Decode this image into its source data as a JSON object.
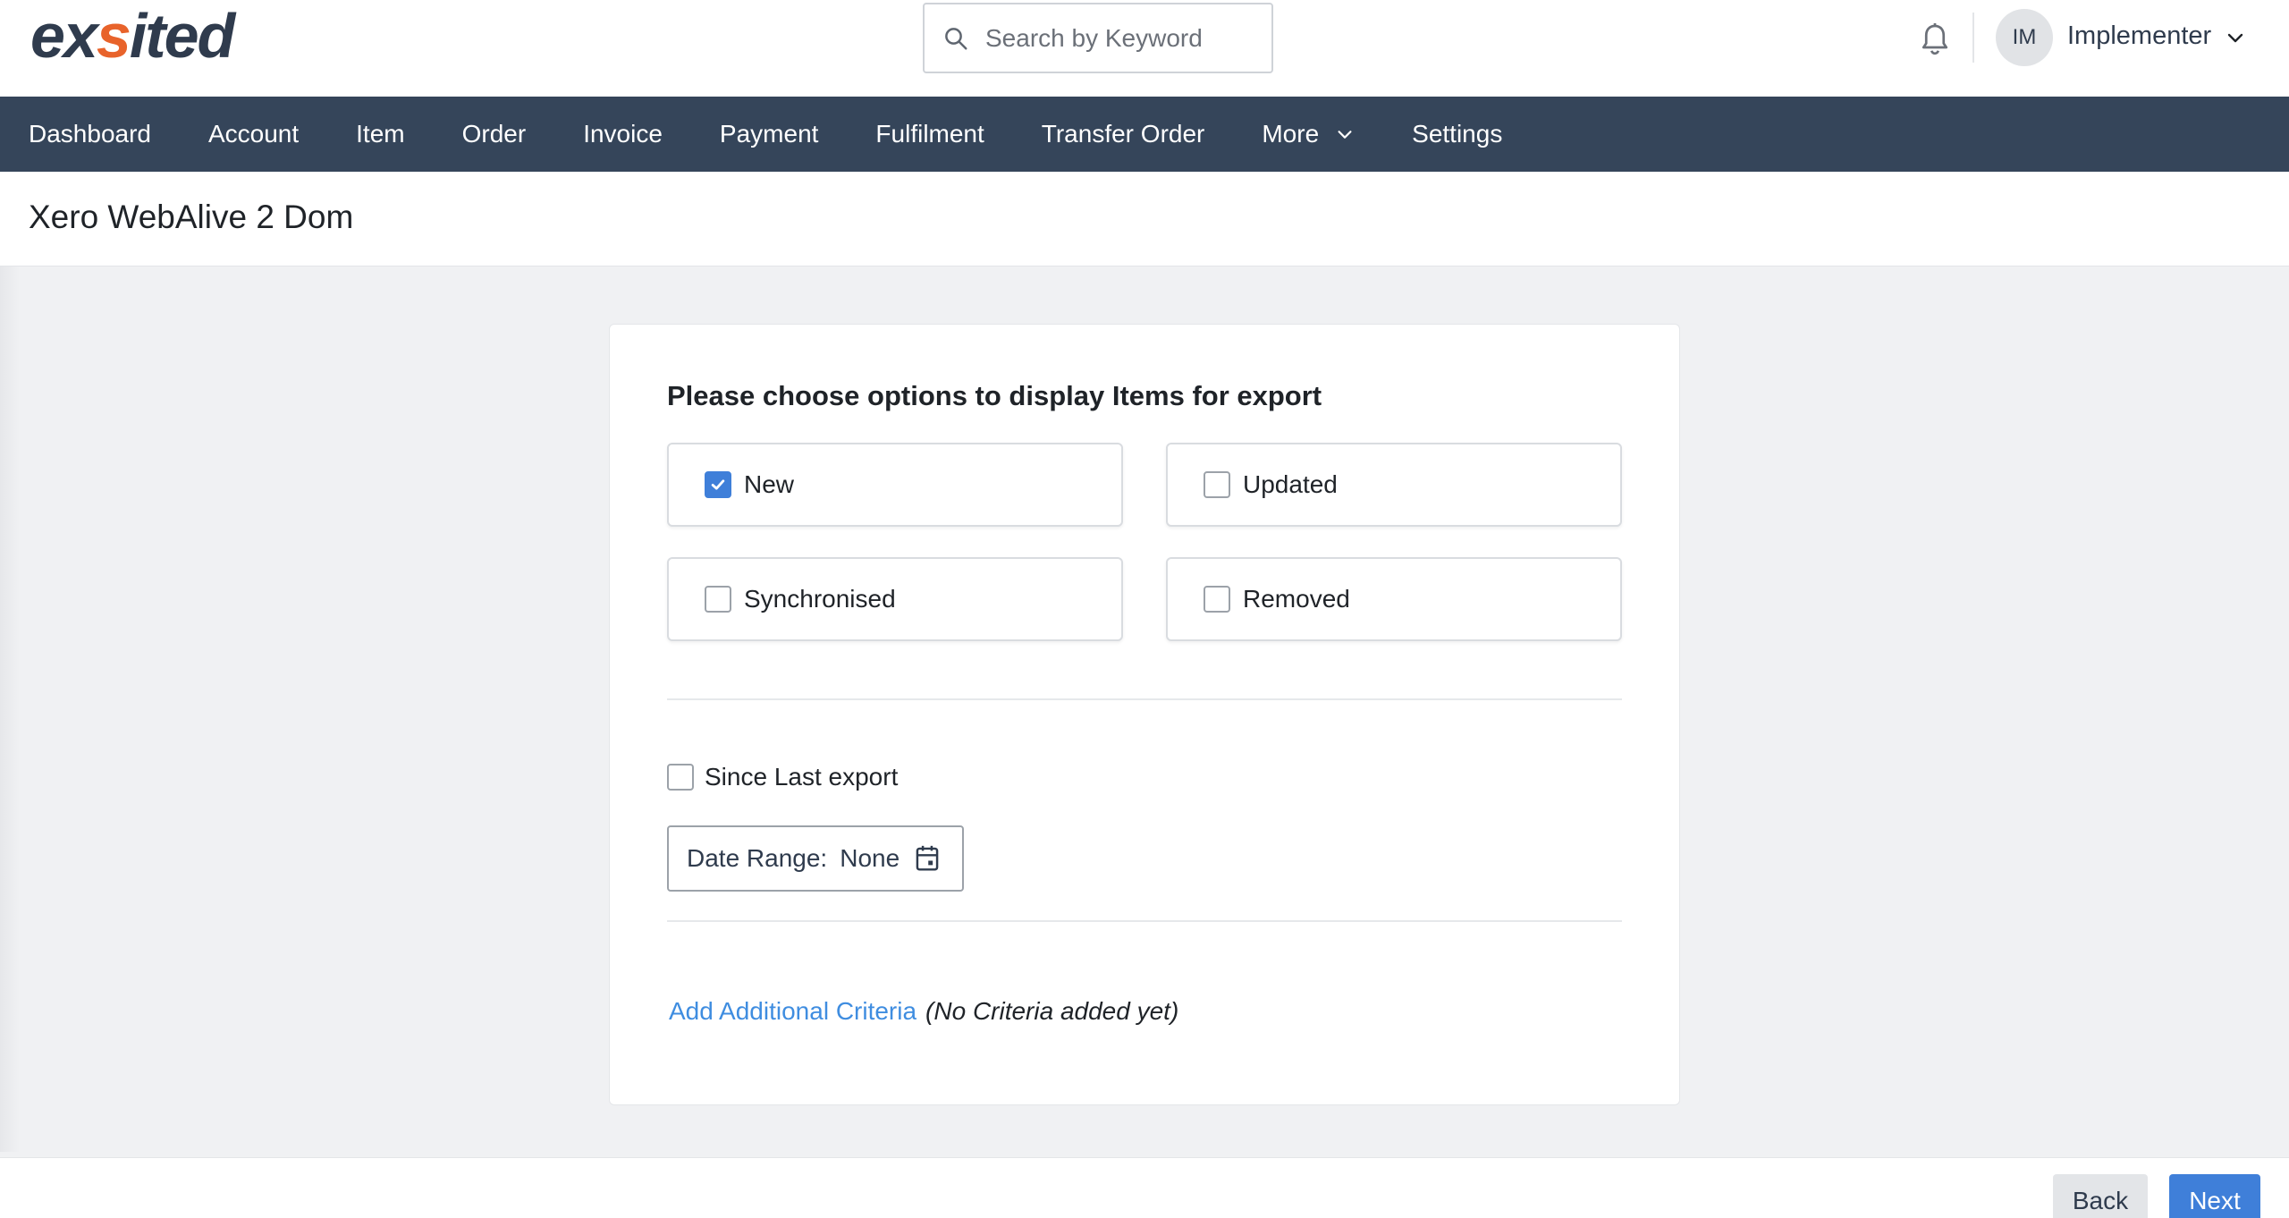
{
  "header": {
    "logo_prefix": "ex",
    "logo_accent": "s",
    "logo_suffix": "ited",
    "search_placeholder": "Search by Keyword",
    "avatar_initials": "IM",
    "user_name": "Implementer"
  },
  "nav": {
    "items": [
      {
        "label": "Dashboard"
      },
      {
        "label": "Account"
      },
      {
        "label": "Item"
      },
      {
        "label": "Order"
      },
      {
        "label": "Invoice"
      },
      {
        "label": "Payment"
      },
      {
        "label": "Fulfilment"
      },
      {
        "label": "Transfer Order"
      },
      {
        "label": "More"
      },
      {
        "label": "Settings"
      }
    ]
  },
  "page": {
    "title": "Xero WebAlive 2 Dom"
  },
  "card": {
    "heading": "Please choose options to display Items for export",
    "options": [
      {
        "label": "New",
        "checked": true
      },
      {
        "label": "Updated",
        "checked": false
      },
      {
        "label": "Synchronised",
        "checked": false
      },
      {
        "label": "Removed",
        "checked": false
      }
    ],
    "since_last_export": {
      "label": "Since Last export",
      "checked": false
    },
    "date_range": {
      "label": "Date Range:",
      "value": "None"
    },
    "criteria": {
      "link_label": "Add Additional Criteria",
      "note": "(No Criteria added yet)"
    }
  },
  "footer": {
    "back_label": "Back",
    "next_label": "Next"
  },
  "colors": {
    "nav_bg": "#35455a",
    "accent_blue": "#3f7fd9",
    "logo_orange": "#e8632b",
    "logo_dark": "#2f3b4d",
    "link_blue": "#3f8de0"
  },
  "icons": [
    "search-icon",
    "bell-icon",
    "chevron-down-icon",
    "check-icon",
    "calendar-icon"
  ]
}
